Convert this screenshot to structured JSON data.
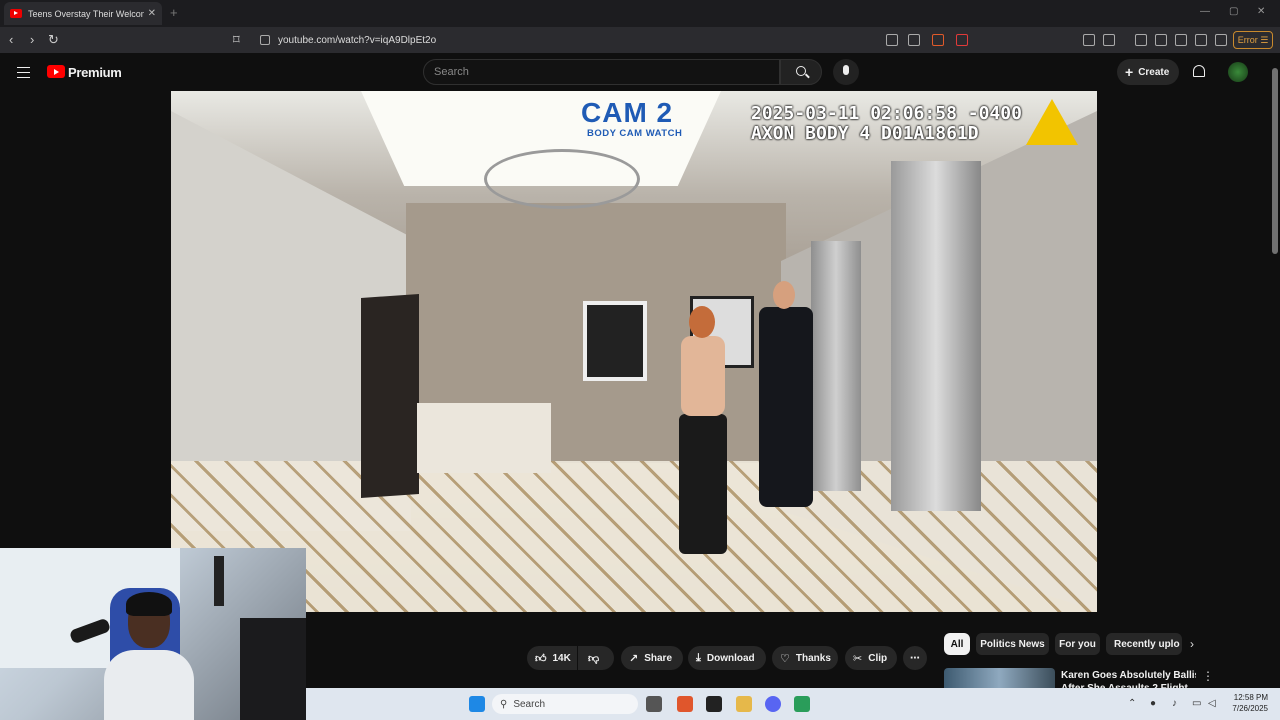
{
  "browser": {
    "tab_title": "Teens Overstay Their Welcom",
    "tab_close": "✕",
    "new_tab": "+",
    "window_controls": [
      "—",
      "▢",
      "✕"
    ],
    "url": "youtube.com/watch?v=iqA9DlpEt2o",
    "error_label": "Error"
  },
  "youtube": {
    "logo_text": "Premium",
    "search_placeholder": "Search",
    "create_label": "Create"
  },
  "video": {
    "timestamp": "2025-03-11 02:06:58 -0400",
    "device": "AXON BODY 4 D01A1861D",
    "cam_label": "CAM 2",
    "cam_sublabel": "BODY CAM WATCH"
  },
  "actions": {
    "like_count": "14K",
    "share": "Share",
    "download": "Download",
    "thanks": "Thanks",
    "clip": "Clip",
    "more": "⋯"
  },
  "chips": [
    "All",
    "Politics News",
    "For you",
    "Recently uplo"
  ],
  "recommendation": {
    "title_line1": "Karen Goes Absolutely Ballistic",
    "title_line2": "After She Assaults 2 Flight"
  },
  "taskbar": {
    "search_placeholder": "Search",
    "time": "12:58 PM",
    "date": "7/26/2025"
  },
  "colors": {
    "bg": "#0f0f0f",
    "youtube_red": "#ff0000",
    "cam_blue": "#1f5bb5",
    "error_orange": "#e0a040"
  }
}
